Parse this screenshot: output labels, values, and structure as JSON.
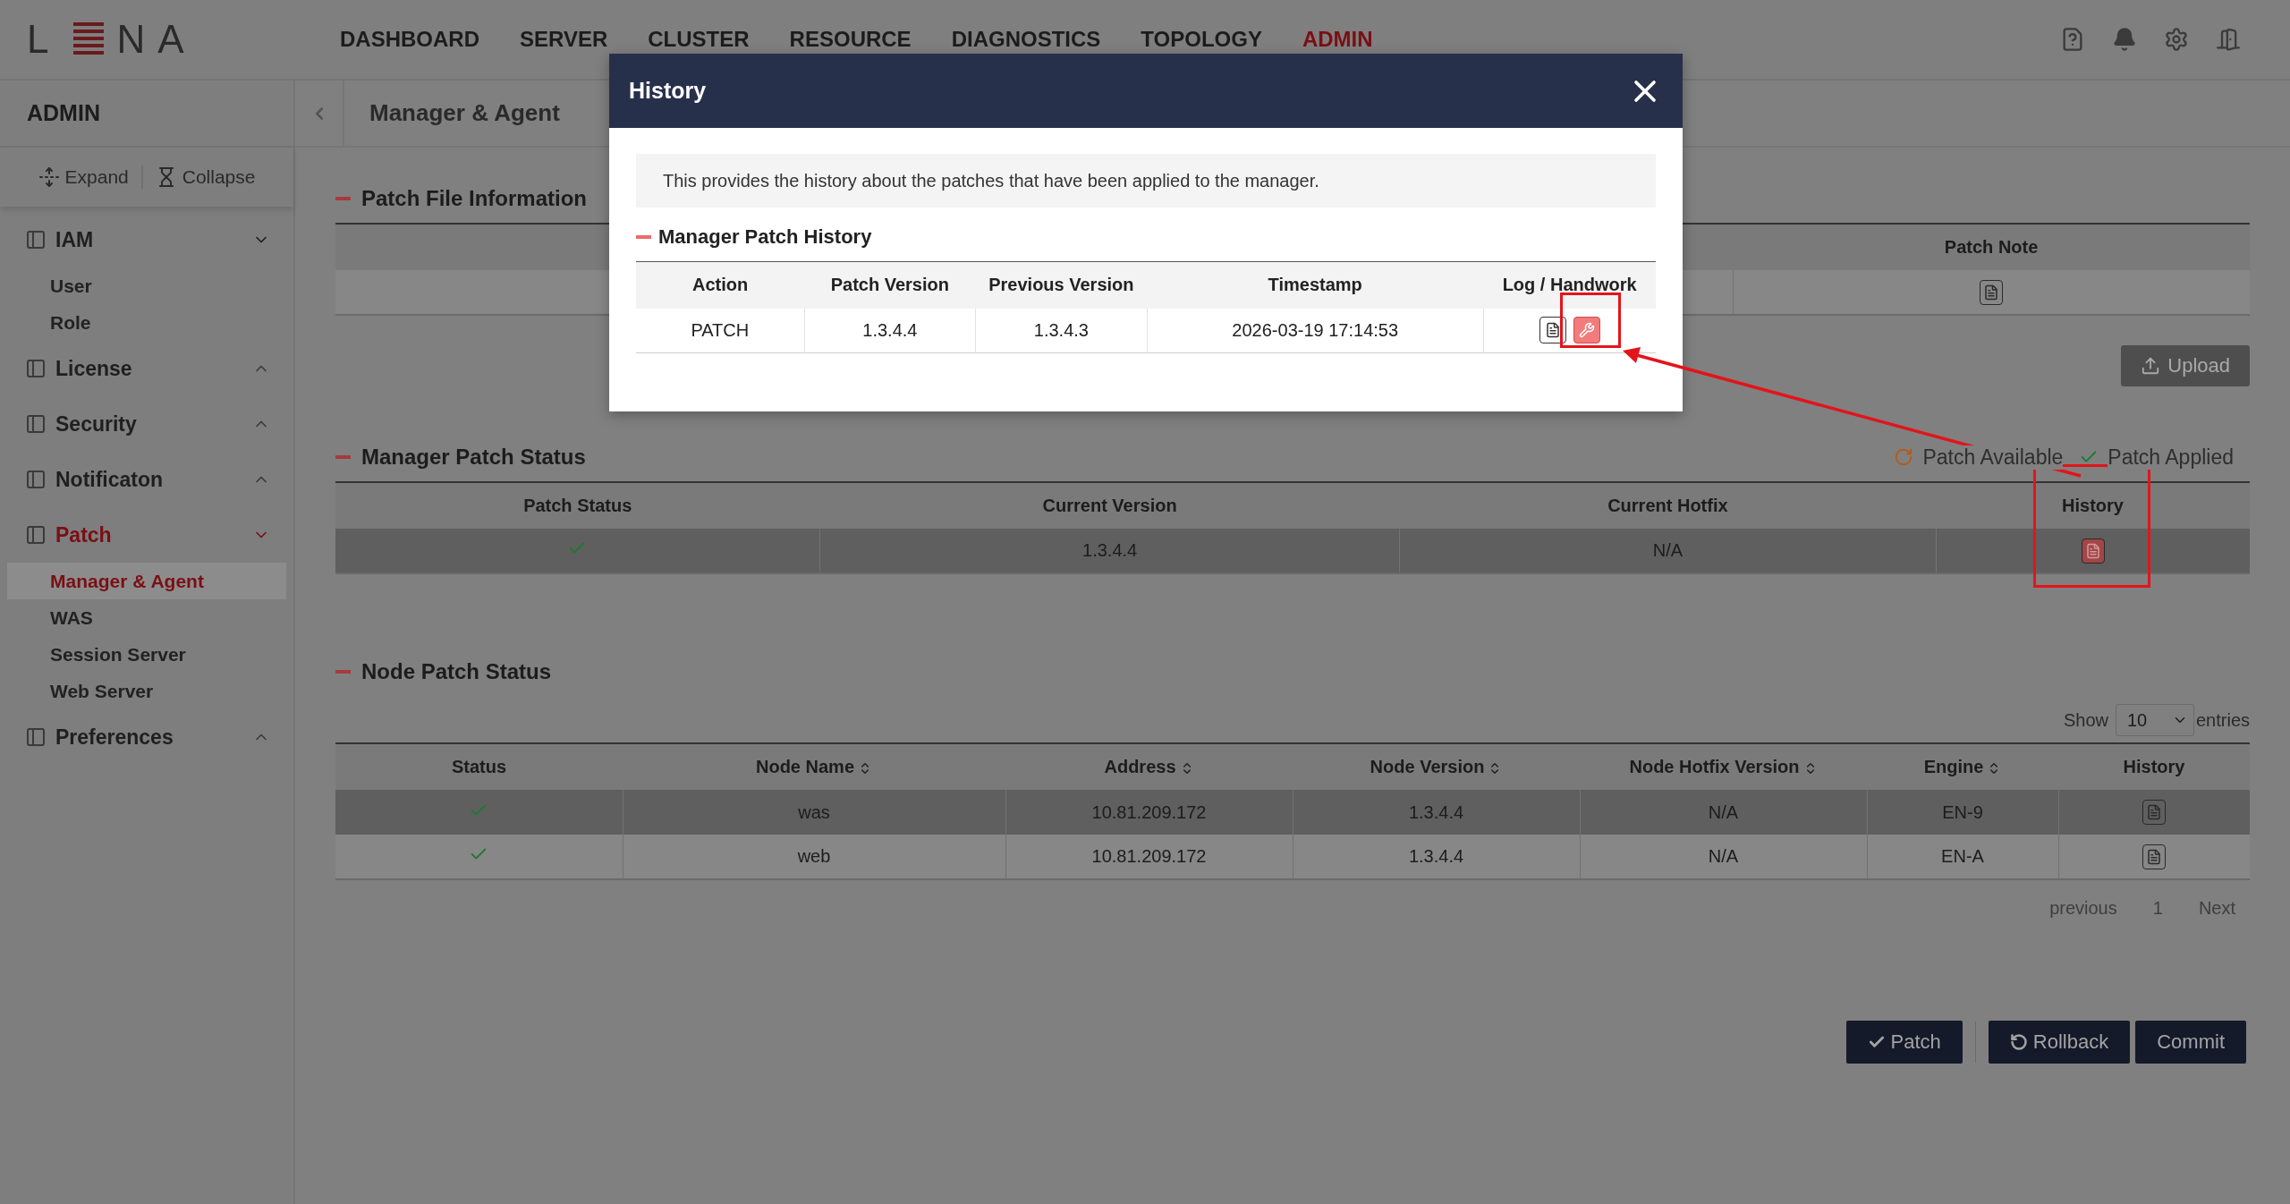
{
  "logo": {
    "left": "L",
    "right": "NA"
  },
  "nav": [
    {
      "label": "DASHBOARD",
      "selected": false
    },
    {
      "label": "SERVER",
      "selected": false
    },
    {
      "label": "CLUSTER",
      "selected": false
    },
    {
      "label": "RESOURCE",
      "selected": false
    },
    {
      "label": "DIAGNOSTICS",
      "selected": false
    },
    {
      "label": "TOPOLOGY",
      "selected": false
    },
    {
      "label": "ADMIN",
      "selected": true
    }
  ],
  "sidebar": {
    "title": "ADMIN",
    "expand": "Expand",
    "collapse": "Collapse",
    "groups": [
      {
        "label": "IAM",
        "expanded": true,
        "selected": false,
        "children": [
          {
            "label": "User",
            "selected": false
          },
          {
            "label": "Role",
            "selected": false
          }
        ]
      },
      {
        "label": "License",
        "expanded": false,
        "selected": false
      },
      {
        "label": "Security",
        "expanded": false,
        "selected": false
      },
      {
        "label": "Notificaton",
        "expanded": false,
        "selected": false
      },
      {
        "label": "Patch",
        "expanded": true,
        "selected": true,
        "children": [
          {
            "label": "Manager & Agent",
            "selected": true
          },
          {
            "label": "WAS",
            "selected": false
          },
          {
            "label": "Session Server",
            "selected": false
          },
          {
            "label": "Web Server",
            "selected": false
          }
        ]
      },
      {
        "label": "Preferences",
        "expanded": false,
        "selected": false
      }
    ]
  },
  "page_title": "Manager & Agent",
  "patch_file": {
    "title": "Patch File Information",
    "columns": [
      "Patch Note"
    ],
    "upload": "Upload"
  },
  "manager_status": {
    "title": "Manager Patch Status",
    "legend": [
      {
        "kind": "available",
        "label": "Patch Available"
      },
      {
        "kind": "applied",
        "label": "Patch Applied"
      }
    ],
    "columns": [
      "Patch Status",
      "Current Version",
      "Current Hotfix",
      "History"
    ],
    "rows": [
      {
        "kind": "applied",
        "version": "1.3.4.4",
        "hotfix": "N/A",
        "selected": true,
        "history_active": true
      }
    ]
  },
  "node_status": {
    "title": "Node Patch Status",
    "show": "Show",
    "page_size": "10",
    "entries": "entries",
    "columns": [
      {
        "label": "Status",
        "sortable": false
      },
      {
        "label": "Node Name",
        "sortable": true
      },
      {
        "label": "Address",
        "sortable": true
      },
      {
        "label": "Node Version",
        "sortable": true
      },
      {
        "label": "Node Hotfix Version",
        "sortable": true
      },
      {
        "label": "Engine",
        "sortable": true
      },
      {
        "label": "History",
        "sortable": false
      }
    ],
    "rows": [
      {
        "kind": "applied",
        "name": "was",
        "address": "10.81.209.172",
        "version": "1.3.4.4",
        "hotfix": "N/A",
        "engine": "EN-9",
        "selected": true
      },
      {
        "kind": "applied",
        "name": "web",
        "address": "10.81.209.172",
        "version": "1.3.4.4",
        "hotfix": "N/A",
        "engine": "EN-A",
        "selected": false
      }
    ],
    "pagination": {
      "previous": "previous",
      "page": "1",
      "next": "Next"
    }
  },
  "actions": [
    {
      "kind": "patch",
      "label": "Patch"
    },
    {
      "kind": "rollback",
      "label": "Rollback"
    },
    {
      "kind": "commit",
      "label": "Commit"
    }
  ],
  "modal": {
    "title": "History",
    "info": "This provides the history about the patches that have been applied to the manager.",
    "subtitle": "Manager Patch History",
    "columns": [
      "Action",
      "Patch Version",
      "Previous Version",
      "Timestamp",
      "Log / Handwork"
    ],
    "rows": [
      {
        "action": "PATCH",
        "patch_version": "1.3.4.4",
        "previous_version": "1.3.4.3",
        "timestamp": "2026-03-19 17:14:53"
      }
    ]
  }
}
